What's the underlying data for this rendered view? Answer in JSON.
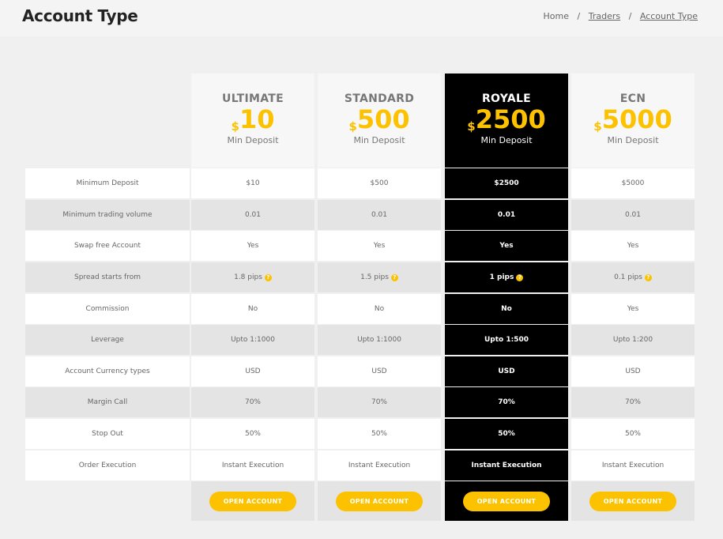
{
  "header": {
    "title": "Account Type",
    "breadcrumb": [
      "Home",
      "Traders",
      "Account Type"
    ]
  },
  "colors": {
    "accent": "#fcc200",
    "highlight_bg": "#000000",
    "row_alt": "#e4e4e4"
  },
  "plans": [
    {
      "name": "ULTIMATE",
      "currency": "$",
      "amount": "10",
      "sub": "Min Deposit",
      "button": "OPEN ACCOUNT"
    },
    {
      "name": "STANDARD",
      "currency": "$",
      "amount": "500",
      "sub": "Min Deposit",
      "button": "OPEN ACCOUNT"
    },
    {
      "name": "ROYALE",
      "currency": "$",
      "amount": "2500",
      "sub": "Min Deposit",
      "button": "OPEN ACCOUNT",
      "highlighted": true
    },
    {
      "name": "ECN",
      "currency": "$",
      "amount": "5000",
      "sub": "Min Deposit",
      "button": "OPEN ACCOUNT"
    }
  ],
  "rows": [
    {
      "label": "Minimum Deposit",
      "values": [
        "$10",
        "$500",
        "$2500",
        "$5000"
      ]
    },
    {
      "label": "Minimum trading volume",
      "values": [
        "0.01",
        "0.01",
        "0.01",
        "0.01"
      ]
    },
    {
      "label": "Swap free Account",
      "values": [
        "Yes",
        "Yes",
        "Yes",
        "Yes"
      ]
    },
    {
      "label": "Spread starts from",
      "values": [
        "1.8 pips",
        "1.5 pips",
        "1 pips",
        "0.1 pips"
      ],
      "help_icon": "question-circle-icon"
    },
    {
      "label": "Commission",
      "values": [
        "No",
        "No",
        "No",
        "Yes"
      ]
    },
    {
      "label": "Leverage",
      "values": [
        "Upto 1:1000",
        "Upto 1:1000",
        "Upto 1:500",
        "Upto 1:200"
      ]
    },
    {
      "label": "Account Currency types",
      "values": [
        "USD",
        "USD",
        "USD",
        "USD"
      ]
    },
    {
      "label": "Margin Call",
      "values": [
        "70%",
        "70%",
        "70%",
        "70%"
      ]
    },
    {
      "label": "Stop Out",
      "values": [
        "50%",
        "50%",
        "50%",
        "50%"
      ]
    },
    {
      "label": "Order Execution",
      "values": [
        "Instant Execution",
        "Instant Execution",
        "Instant Execution",
        "Instant Execution"
      ]
    }
  ]
}
